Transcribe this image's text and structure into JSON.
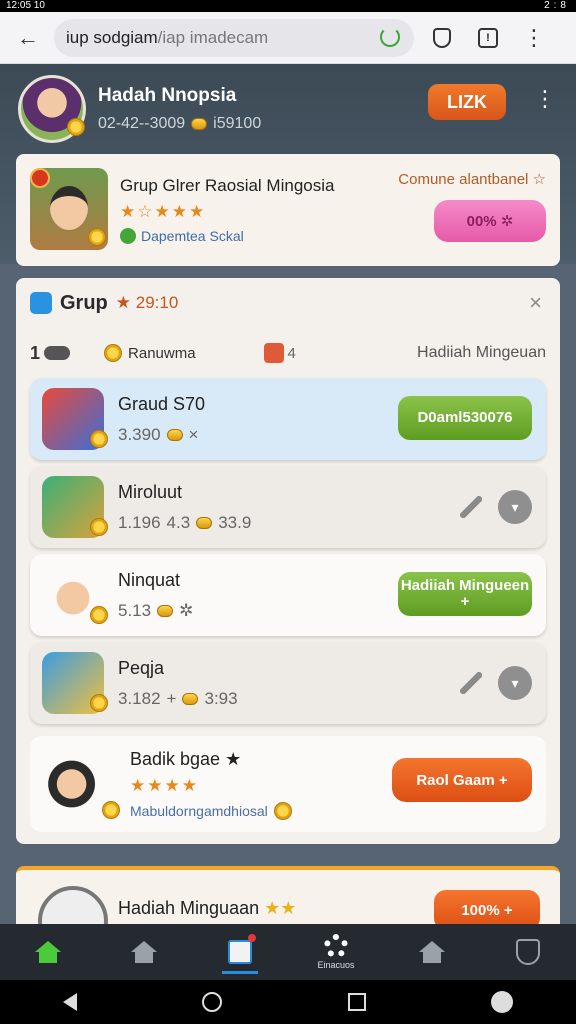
{
  "status": {
    "time": "12:05 10",
    "right": "2:8"
  },
  "browser": {
    "url_host": "iup sodgiam",
    "url_path": "/iap imadecam",
    "tab_label": "!"
  },
  "profile": {
    "name": "Hadah Nnopsia",
    "stats": "02-42--3009",
    "coins": "i59100",
    "level": "LIZK"
  },
  "banner": {
    "title": "Grup Glrer Raosial Mingosia",
    "stars": "★☆★★★",
    "verified": "Dapemtea Sckal",
    "tag": "Comune alantbanel ☆",
    "button": "00% ✲"
  },
  "group": {
    "title": "Grup",
    "meta": "★ 29:10",
    "rank": "1",
    "coin_label": "Ranuwma",
    "badge_num": "4",
    "right_label": "Hadiiah Mingeuan",
    "close": "×"
  },
  "rows": [
    {
      "name": "Graud S70",
      "s1": "3.390",
      "s2": "×",
      "button": "D0aml530076"
    },
    {
      "name": "Miroluut",
      "s1": "1.196",
      "s2": "4.3",
      "s3": "33.9"
    },
    {
      "name": "Ninquat",
      "s1": "5.13",
      "s2": "✲",
      "button": "Hadiiah Mingueen +"
    },
    {
      "name": "Peqja",
      "s1": "3.182",
      "s2": "+",
      "s3": "3:93"
    },
    {
      "name": "Badik bgae ★",
      "stars": "★★★★",
      "sub": "Mabuldorngamdhiosal",
      "button": "Raol Gaam +"
    }
  ],
  "bottom": {
    "title": "Hadiah Minguaan",
    "stars": "★★",
    "button": "100% +"
  },
  "nav": {
    "settings_label": "Einacuos"
  },
  "colors": {
    "accent_orange": "#dc4f14",
    "accent_green": "#5f9d22",
    "accent_blue": "#2a8be0"
  }
}
